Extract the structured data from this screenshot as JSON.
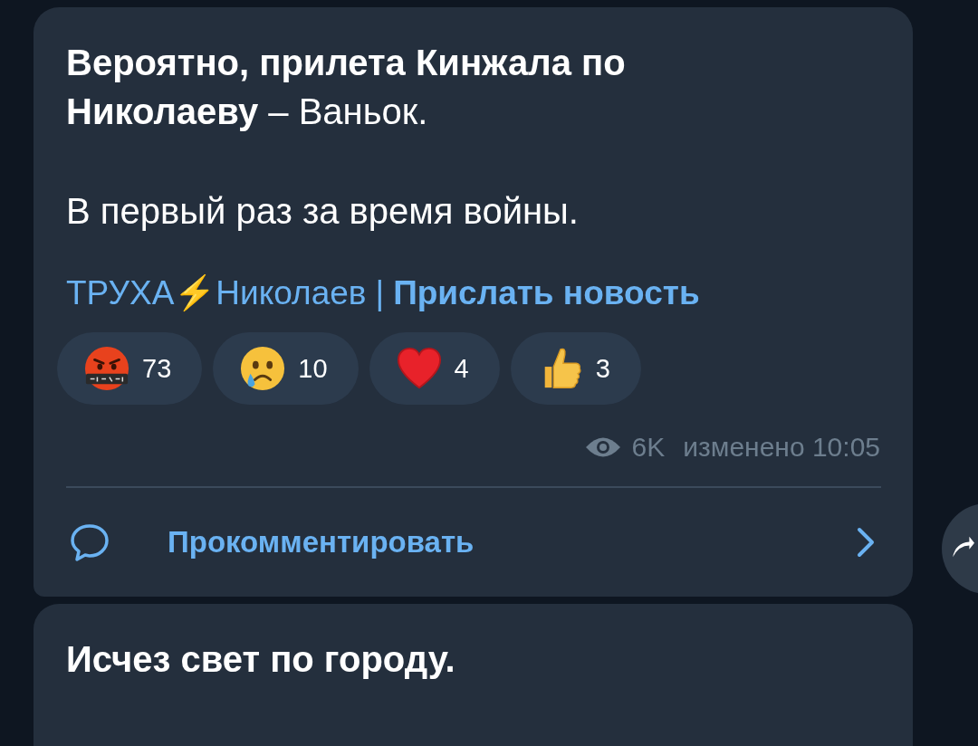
{
  "messages": [
    {
      "kind": "post",
      "paragraphs": [
        "**Вероятно, прилета Кинжала по Николаеву** – Ваньок.",
        "В первый раз за время войны."
      ],
      "footer": {
        "channel_link": "ТРУХА⚡Николаев",
        "separator": "|",
        "submit_link": "Прислать новость"
      },
      "reactions": [
        {
          "kind": "angry",
          "count": "73"
        },
        {
          "kind": "crying",
          "count": "10"
        },
        {
          "kind": "heart",
          "count": "4"
        },
        {
          "kind": "thumbs",
          "count": "3"
        }
      ],
      "views": "6K",
      "edited": "изменено 10:05",
      "comment_button": "Прокомментировать"
    },
    {
      "kind": "post",
      "paragraphs": [
        "**Исчез свет по городу.**"
      ]
    }
  ]
}
